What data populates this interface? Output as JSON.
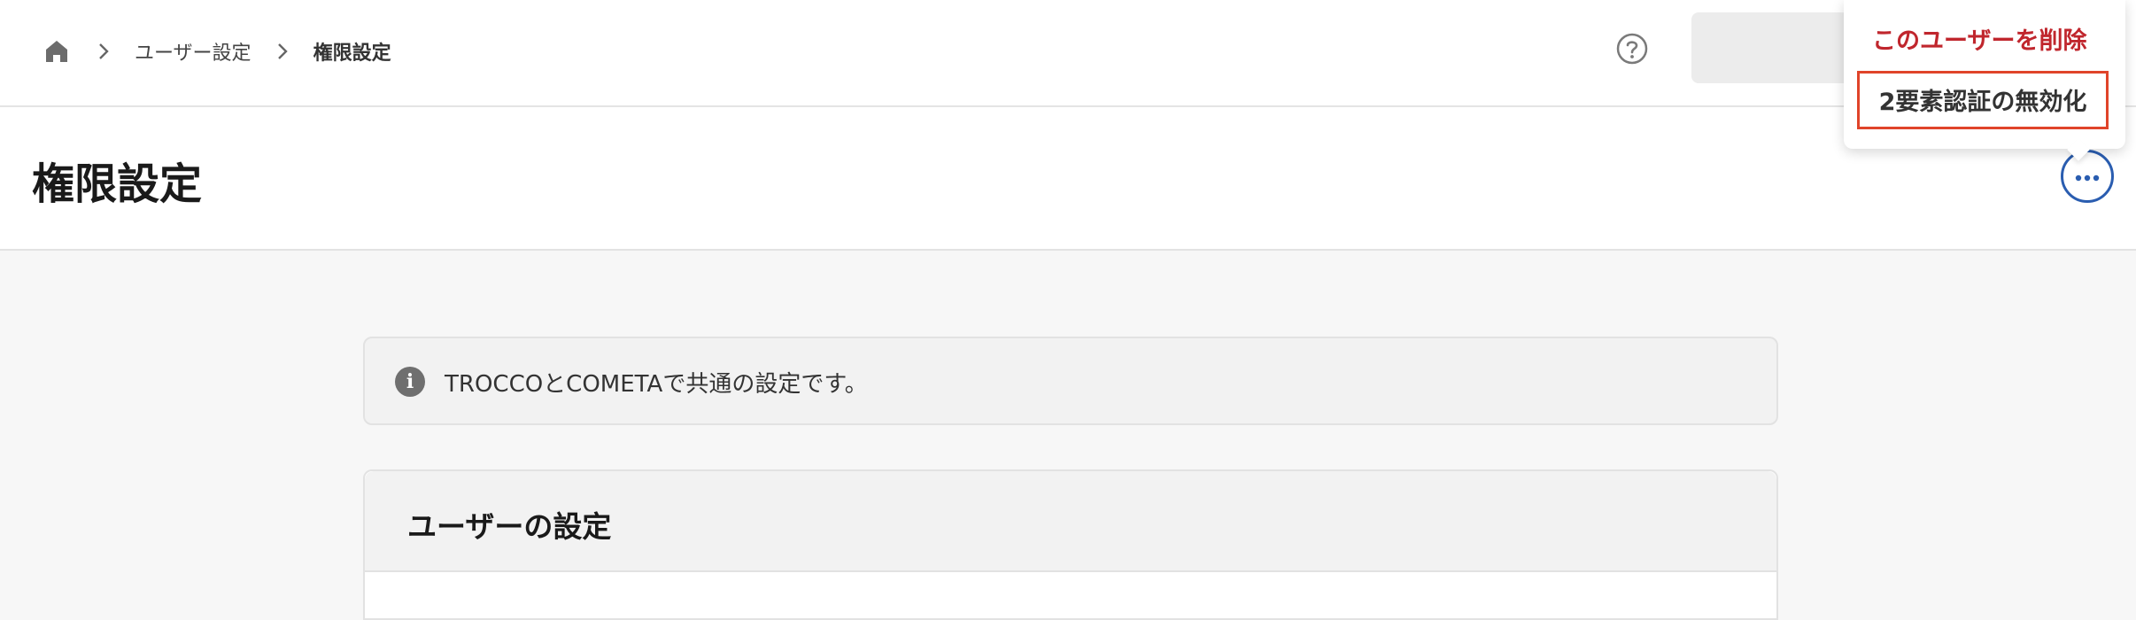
{
  "breadcrumb": {
    "parent_label": "ユーザー設定",
    "current_label": "権限設定"
  },
  "page": {
    "title": "権限設定"
  },
  "menu": {
    "delete_user_label": "このユーザーを削除",
    "disable_2fa_label": "2要素認証の無効化"
  },
  "info": {
    "message": "TROCCOとCOMETAで共通の設定です。"
  },
  "user_settings": {
    "title": "ユーザーの設定"
  },
  "icons": {
    "home": "home-icon",
    "separator": "chevron-right-icon",
    "help": "help-circle-icon",
    "more": "more-horizontal-icon",
    "info": "info-icon"
  },
  "colors": {
    "accent_blue": "#2a5db0",
    "danger_red": "#c0262d",
    "highlight_border": "#e0442a"
  }
}
